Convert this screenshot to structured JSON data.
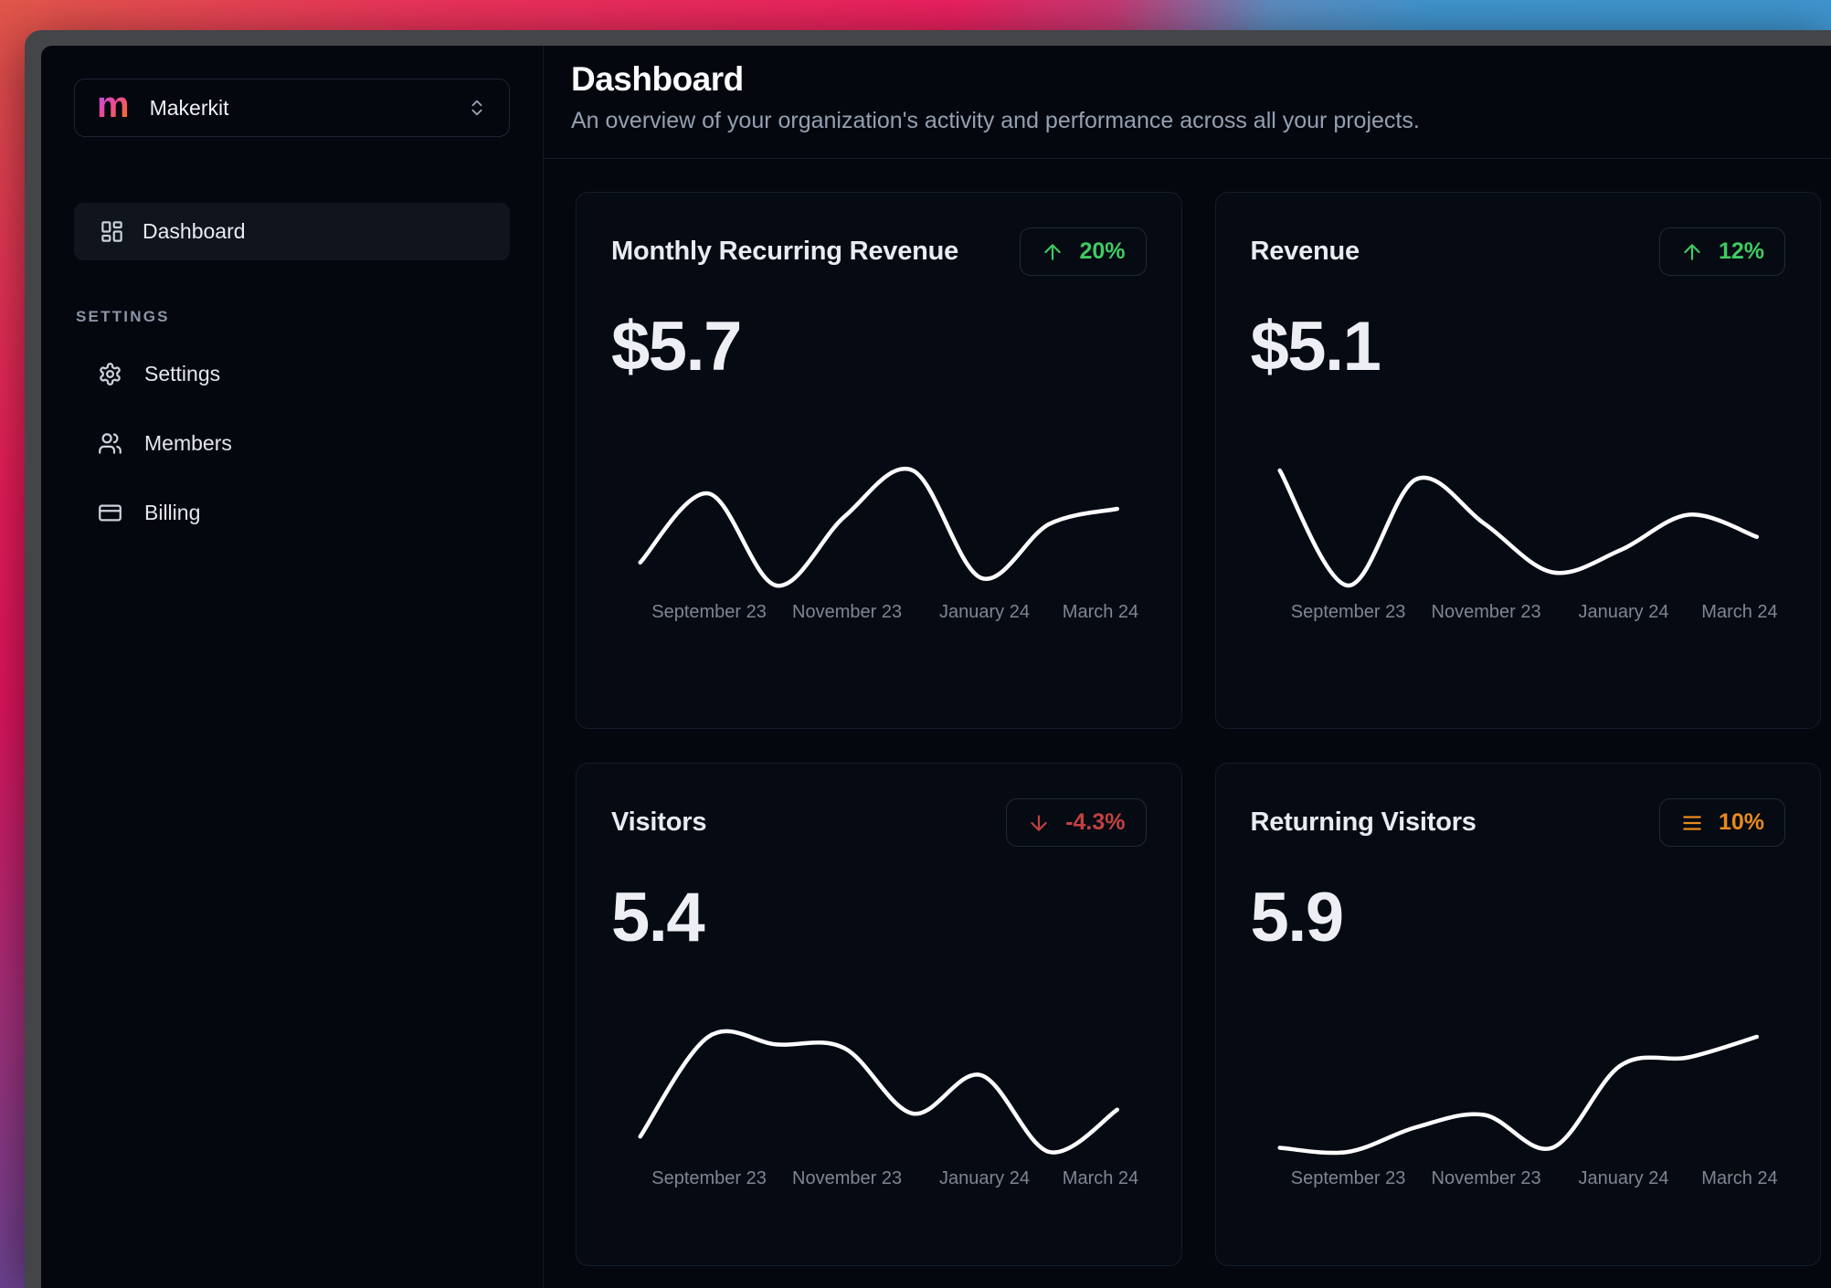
{
  "workspace": {
    "logo_letter": "m",
    "name": "Makerkit"
  },
  "sidebar": {
    "nav": [
      {
        "label": "Dashboard"
      }
    ],
    "section_label": "SETTINGS",
    "settings_nav": [
      {
        "label": "Settings"
      },
      {
        "label": "Members"
      },
      {
        "label": "Billing"
      }
    ]
  },
  "header": {
    "title": "Dashboard",
    "subtitle": "An overview of your organization's activity and performance across all your projects."
  },
  "cards": [
    {
      "title": "Monthly Recurring Revenue",
      "badge": "20%",
      "trend": "up",
      "value": "$5.7"
    },
    {
      "title": "Revenue",
      "badge": "12%",
      "trend": "up",
      "value": "$5.1"
    },
    {
      "title": "Visitors",
      "badge": "-4.3%",
      "trend": "down",
      "value": "5.4"
    },
    {
      "title": "Returning Visitors",
      "badge": "10%",
      "trend": "flat",
      "value": "5.9"
    }
  ],
  "colors": {
    "trend_up": "#3fcb62",
    "trend_down": "#c34141",
    "trend_flat": "#e98a1c",
    "sparkline": "#ffffff",
    "logo_gradient": [
      "#a855f7",
      "#ec4899",
      "#f97316"
    ]
  },
  "chart_data": [
    {
      "type": "line",
      "title": "Monthly Recurring Revenue",
      "x_ticks": [
        "September 23",
        "November 23",
        "January 24",
        "March 24"
      ],
      "tick_point_indices": [
        1,
        3,
        5,
        7
      ],
      "values": [
        5.0,
        5.9,
        4.7,
        5.6,
        6.2,
        4.8,
        5.5,
        5.7
      ],
      "ylim": [
        4.5,
        6.4
      ],
      "grid": false,
      "legend": "none"
    },
    {
      "type": "line",
      "title": "Revenue",
      "x_ticks": [
        "September 23",
        "November 23",
        "January 24",
        "March 24"
      ],
      "tick_point_indices": [
        1,
        3,
        5,
        7
      ],
      "values": [
        6.0,
        4.7,
        5.9,
        5.4,
        4.85,
        5.1,
        5.5,
        5.25
      ],
      "ylim": [
        4.5,
        6.2
      ],
      "grid": false,
      "legend": "none"
    },
    {
      "type": "line",
      "title": "Visitors",
      "x_ticks": [
        "September 23",
        "November 23",
        "January 24",
        "March 24"
      ],
      "tick_point_indices": [
        1,
        3,
        5,
        7
      ],
      "values": [
        4.7,
        6.0,
        5.9,
        5.85,
        5.0,
        5.5,
        4.5,
        5.05
      ],
      "ylim": [
        4.3,
        6.2
      ],
      "grid": false,
      "legend": "none"
    },
    {
      "type": "line",
      "title": "Returning Visitors",
      "x_ticks": [
        "September 23",
        "November 23",
        "January 24",
        "March 24"
      ],
      "tick_point_indices": [
        1,
        3,
        5,
        7
      ],
      "values": [
        4.65,
        4.6,
        4.9,
        5.05,
        4.65,
        5.65,
        5.75,
        6.0
      ],
      "ylim": [
        4.4,
        6.2
      ],
      "grid": false,
      "legend": "none"
    }
  ]
}
